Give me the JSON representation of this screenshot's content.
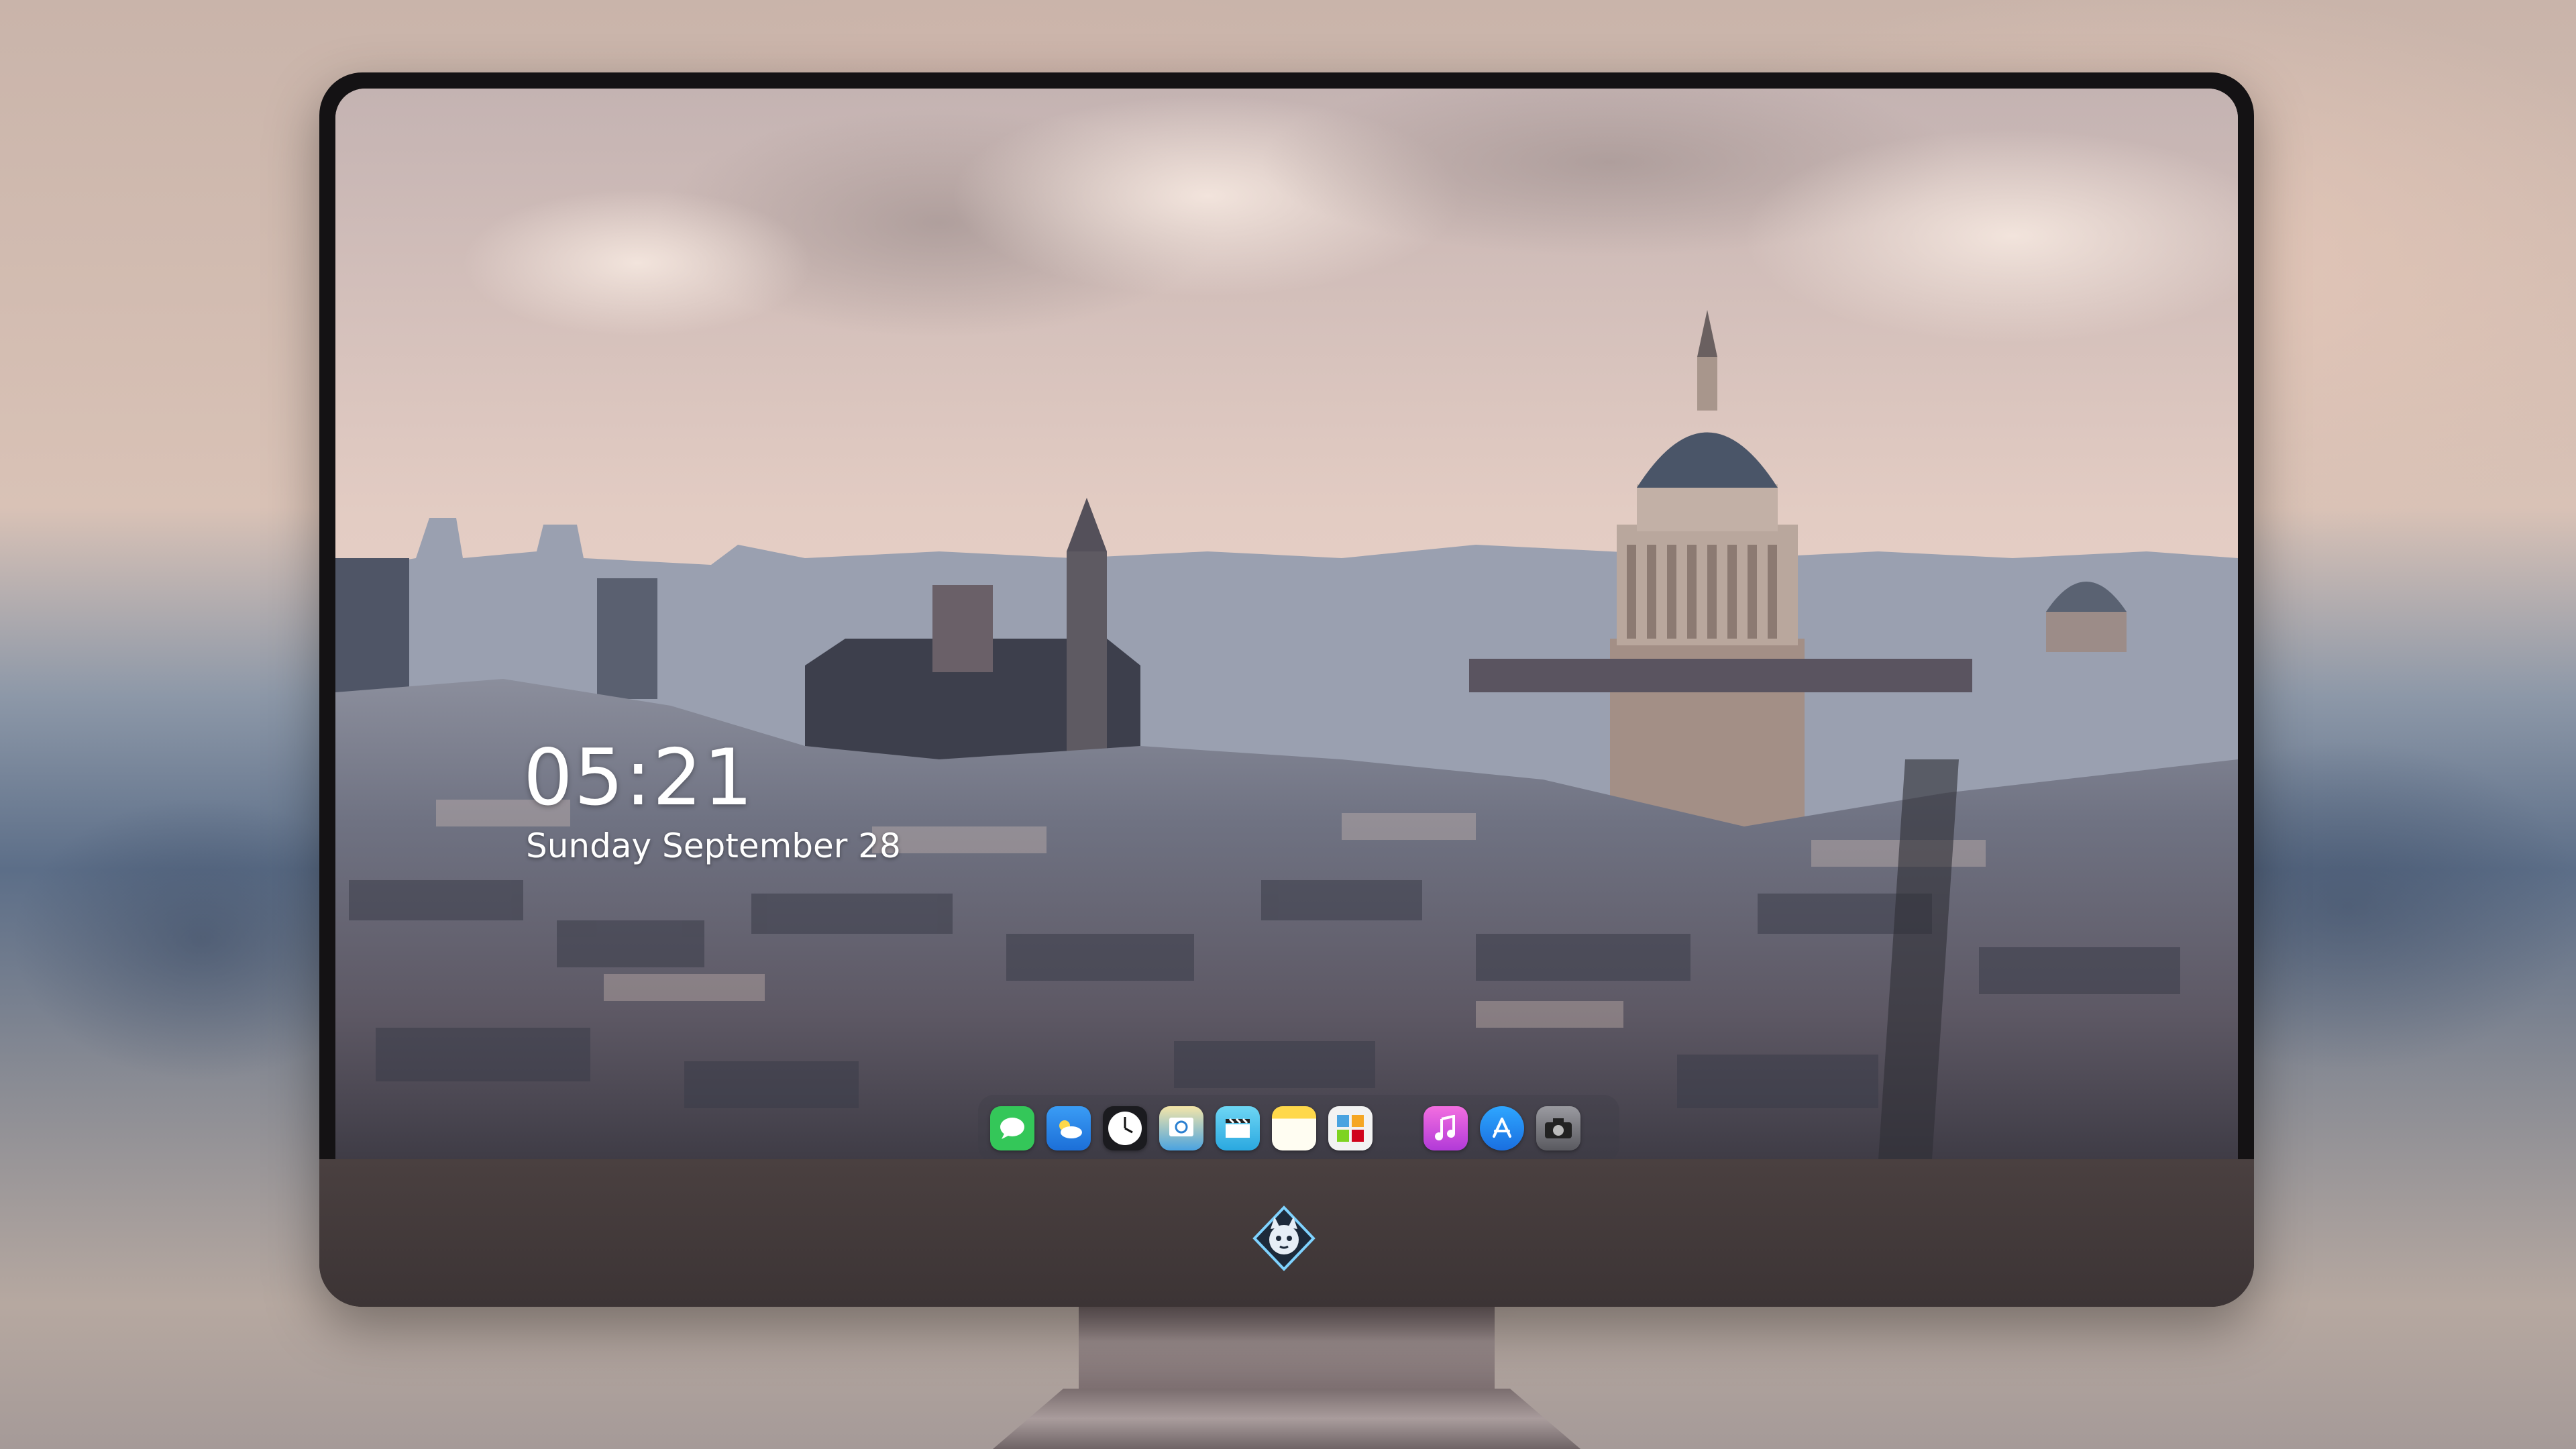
{
  "lock_screen": {
    "time": "05:21",
    "date": "Sunday September  28"
  },
  "dock": {
    "apps": [
      {
        "name": "messages-icon",
        "color": "#34c759"
      },
      {
        "name": "weather-icon",
        "color": "#2f8cf0"
      },
      {
        "name": "clock-icon",
        "color": "#ffffff"
      },
      {
        "name": "preview-icon",
        "color": "#e9d27a"
      },
      {
        "name": "video-icon",
        "color": "#3bb6e0"
      },
      {
        "name": "notes-icon",
        "color": "#ffd84a"
      },
      {
        "name": "photos-icon",
        "color": "#f2f2f2"
      },
      {
        "name": "music-icon",
        "color": "#e45bd8"
      },
      {
        "name": "app-store-icon",
        "color": "#1e8cf5"
      },
      {
        "name": "camera-icon",
        "color": "#7a7a80"
      }
    ]
  }
}
